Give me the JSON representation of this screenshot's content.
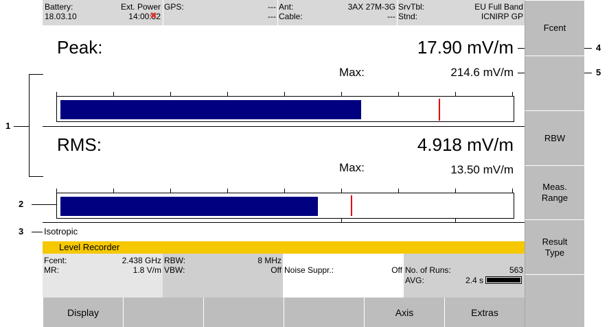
{
  "status": {
    "battery_label": "Battery:",
    "date": "18.03.10",
    "ext_power_label": "Ext. Power",
    "time": "14:00:32",
    "gps_label": "GPS:",
    "gps_value": "---",
    "cable_value": "---",
    "ant_label": "Ant:",
    "ant_value": "3AX 27M-3G",
    "cable_label": "Cable:",
    "cable_dash": "---",
    "srvtbl_label": "SrvTbl:",
    "srvtbl_value": "EU Full Band",
    "stnd_label": "Stnd:",
    "stnd_value": "ICNIRP GP"
  },
  "peak": {
    "label": "Peak:",
    "value": "17.90 mV/m",
    "max_label": "Max:",
    "max_value": "214.6 mV/m",
    "bar_fraction": 0.669,
    "max_marker_fraction": 0.841
  },
  "rms": {
    "label": "RMS:",
    "value": "4.918 mV/m",
    "max_label": "Max:",
    "max_value": "13.50 mV/m",
    "bar_fraction": 0.573,
    "max_marker_fraction": 0.646
  },
  "antenna_mode": "Isotropic",
  "callouts": {
    "c1": "1",
    "c2": "2",
    "c3": "3",
    "c4": "4",
    "c5": "5"
  },
  "level_recorder": {
    "title": "Level Recorder",
    "fcent_label": "Fcent:",
    "fcent_value": "2.438 GHz",
    "mr_label": "MR:",
    "mr_value": "1.8 V/m",
    "rbw_label": "RBW:",
    "rbw_value": "8 MHz",
    "vbw_label": "VBW:",
    "vbw_value": "Off",
    "noise_label": "Noise Suppr.:",
    "noise_value": "Off",
    "runs_label": "No. of Runs:",
    "runs_value": "563",
    "avg_label": "AVG:",
    "avg_value": "2.4 s"
  },
  "softkeys": [
    "Fcent",
    "",
    "",
    "RBW",
    "Meas.\nRange",
    "Result\nType",
    ""
  ],
  "bottom_keys": [
    "Display",
    "",
    "",
    "",
    "Axis",
    "Extras"
  ],
  "colors": {
    "bar": "#000080",
    "marker": "#e00000",
    "header": "#f5c800"
  }
}
